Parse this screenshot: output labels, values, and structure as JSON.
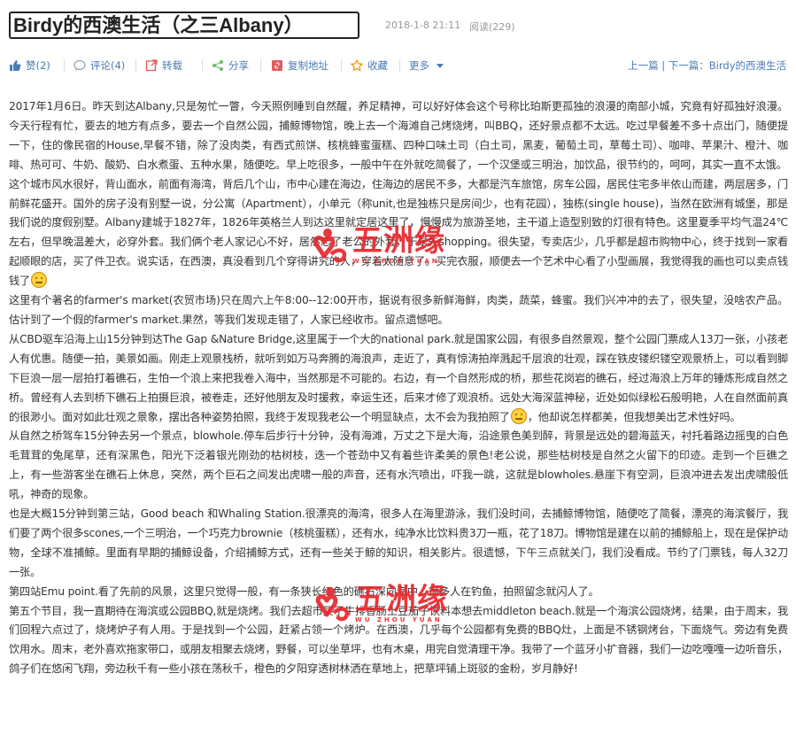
{
  "header": {
    "title": "Birdy的西澳生活（之三Albany）",
    "date": "2018-1-8 21:11",
    "views": "阅读(229)"
  },
  "toolbar": {
    "like": "赞(2)",
    "comment": "评论(4)",
    "repost": "转载",
    "share": "分享",
    "copy_link": "复制地址",
    "favorite": "收藏",
    "more": "更多",
    "prev": "上一篇",
    "separator": " | ",
    "next": "下一篇：Birdy的西澳生活"
  },
  "colors": {
    "link": "#4b7cb5",
    "watermark": "#e8272d"
  },
  "watermark": {
    "name": "五洲缘",
    "sub": "WU ZHOU YUAN"
  },
  "article": {
    "p1": "2017年1月6日。昨天到达Albany,只是匆忙一瞥，今天照例睡到自然醒，养足精神，可以好好体会这个号称比珀斯更孤独的浪漫的南部小城，究竟有好孤独好浪漫。今天行程有忙，要去的地方有点多，要去一个自然公园，捕鲸博物馆，晚上去一个海滩自己烤烧烤，叫BBQ，还好景点都不太远。吃过早餐差不多十点出门，随便提一下，住的像民宿的House,早餐不错，除了没肉类，有西式煎饼、核桃蜂蜜蛋糕、四种口味土司（白土司，黑麦，葡萄土司，草莓土司）、咖啡、苹果汁、橙汁、咖啡、热可可、牛奶、酸奶、白水煮蛋、五种水果，随便吃。早上吃很多，一般中午在外就吃简餐了，一个汉堡或三明治，加饮品，很节约的，呵呵，其实一直不太饿。",
    "p2a": "这个城市风水很好，背山面水，前面有海湾，背后几个山，市中心建在海边，住海边的居民不多，大都是汽车旅馆，房车公园，居民住宅多半依山而建，两层居多，门前鲜花盛开。国外的房子没有别墅一说，分公寓（Apartment），小单元（称unit,也是独栋只是房间少，也有花园），独栋(single house)，当然在欧洲有城堡，那是我们说的度假别墅。Albany建城于1827年，1826年英格兰人到达这里就定居这里了，慢慢成为旅游圣地，主干道上造型别致的灯很有特色。这里夏季平均气温24℃左右，但早晚温差大，必穿外套。我们俩个老人家记心不好，居然忘了老公的外套，于是先shopping。很失望，专卖店少，几乎都是超市购物中心，终于找到一家看起顺眼的店，买了件卫衣。说实话，在西澳，真没看到几个穿得讲究的人，穿着太随意了。买完衣服，顺便去一个艺术中心看了小型画展，我觉得我的画也可以卖点钱钱了",
    "p3": "这里有个著名的farmer's market(农贸市场)只在周六上午8:00--12:00开市，据说有很多新鲜海鲜，肉类，蔬菜，蜂蜜。我们兴冲冲的去了，很失望，没啥农产品。估计到了一个假的farmer's market.果然，等我们发现走错了，人家已经收市。留点遗憾吧。",
    "p4a": "从CBD驱车沿海上山15分钟到达The Gap &Nature Bridge,这里属于一个大的national park.就是国家公园，有很多自然景观，整个公园门票成人13刀一张，小孩老人有优惠。随便一拍，美景如画。刚走上观景栈桥，就听到如万马奔腾的海浪声，走近了，真有惊涛拍岸溅起千层浪的壮观，踩在铁皮镂织镂空观景桥上，可以看到脚下巨浪一层一层拍打着礁石，生怕一个浪上来把我卷入海中，当然那是不可能的。右边，有一个自然形成的桥，那些花岗岩的礁石，经过海浪上万年的锤炼形成自然之桥。曾经有人去到桥下礁石上拍摄巨浪，被卷走，还好他朋友及时援救，幸运生还，后来才修了观浪桥。远处大海深蓝神秘，近处如似绿松石般明艳，人在自然面前真的很渺小。面对如此壮观之景象，摆出各种姿势拍照，我终于发现我老公一个明显缺点，太不会为我拍照了",
    "p4b": "，他却说怎样都美，但我想美出艺术性好吗。",
    "p5": "从自然之桥驾车15分钟去另一个景点，blowhole.停车后步行十分钟，没有海滩，万丈之下是大海，沿途景色美到醉，背景是远处的碧海蓝天，衬托着路边摇曳的白色毛茸茸的兔尾草，还有深黑色，阳光下泛着银光刚劲的枯树枝，迭一个苍劲中又有着些许柔美的景色!老公说，那些枯树枝是自然之火留下的印迹。走到一个巨礁之上，有一些游客坐在礁石上休息，突然，两个巨石之间发出虎啸一般的声音，还有水汽喷出，吓我一跳，这就是blowholes.悬崖下有空洞，巨浪冲进去发出虎啸般低吼，神奇的现象。",
    "p6": "也是大概15分钟到第三站，Good beach 和Whaling Station.很漂亮的海湾，很多人在海里游泳，我们没时间，去捕鲸博物馆，随便吃了简餐，漂亮的海滨餐厅，我们要了两个很多scones,一个三明治，一个巧克力brownie（核桃蛋糕），还有水，纯净水比饮料贵3刀一瓶，花了18刀。博物馆是建在以前的捕鲸船上，现在是保护动物，全球不准捕鲸。里面有早期的捕鲸设备，介绍捕鲸方式，还有一些关于鲸的知识，相关影片。很遗憾，下午三点就关门，我们没看成。节约了门票钱，每人32刀一张。",
    "p7": "第四站Emu point.看了先前的风景，这里只觉得一般，有一条狭长红色的礁石深向海中，很多人在钓鱼，拍照留念就闪人了。",
    "p8": "第五个节目，我一直期待在海滨或公园BBQ,就是烧烤。我们去超市买了牛排香肠土豆茄子饮料本想去middleton beach.就是一个海滨公园烧烤，结果，由于周末，我们回程六点过了，烧烤炉子有人用。于是找到一个公园，赶紧占领一个烤炉。在西澳，几乎每个公园都有免费的BBQ灶，上面是不锈钢烤台，下面烧气。旁边有免费饮用水。周末，老外喜欢拖家带口，或朋友相聚去烧烤，野餐，可以坐草坪，也有木桌，用完自觉清理干净。我带了一个蓝牙小扩音器，我们一边吃嘎嘎一边听音乐，鸽子们在悠闲飞翔，旁边秋千有一些小孩在荡秋千，橙色的夕阳穿透树林洒在草地上，把草坪铺上斑驳的金粉，岁月静好!"
  }
}
